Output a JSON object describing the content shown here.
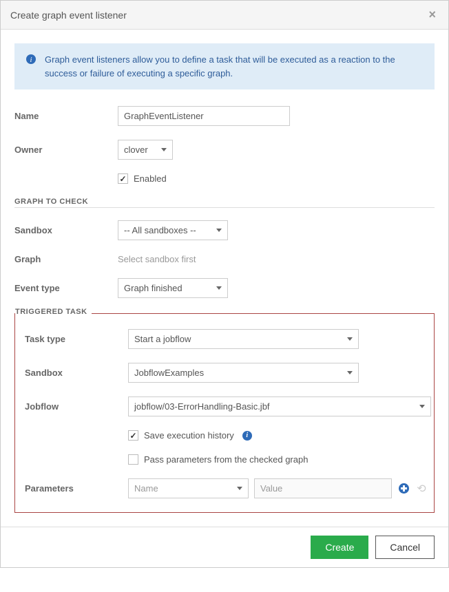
{
  "header": {
    "title": "Create graph event listener"
  },
  "info": {
    "text": "Graph event listeners allow you to define a task that will be executed as a reaction to the success or failure of executing a specific graph."
  },
  "fields": {
    "name_label": "Name",
    "name_value": "GraphEventListener",
    "owner_label": "Owner",
    "owner_value": "clover",
    "enabled_label": "Enabled",
    "enabled_checked": true
  },
  "section_graph": {
    "header": "GRAPH TO CHECK",
    "sandbox_label": "Sandbox",
    "sandbox_value": "-- All sandboxes --",
    "graph_label": "Graph",
    "graph_value": "Select sandbox first",
    "event_type_label": "Event type",
    "event_type_value": "Graph finished"
  },
  "section_task": {
    "header": "TRIGGERED TASK",
    "task_type_label": "Task type",
    "task_type_value": "Start a jobflow",
    "sandbox_label": "Sandbox",
    "sandbox_value": "JobflowExamples",
    "jobflow_label": "Jobflow",
    "jobflow_value": "jobflow/03-ErrorHandling-Basic.jbf",
    "save_history_label": "Save execution history",
    "save_history_checked": true,
    "pass_params_label": "Pass parameters from the checked graph",
    "pass_params_checked": false,
    "parameters_label": "Parameters",
    "param_name_placeholder": "Name",
    "param_value_placeholder": "Value"
  },
  "footer": {
    "create_label": "Create",
    "cancel_label": "Cancel"
  }
}
